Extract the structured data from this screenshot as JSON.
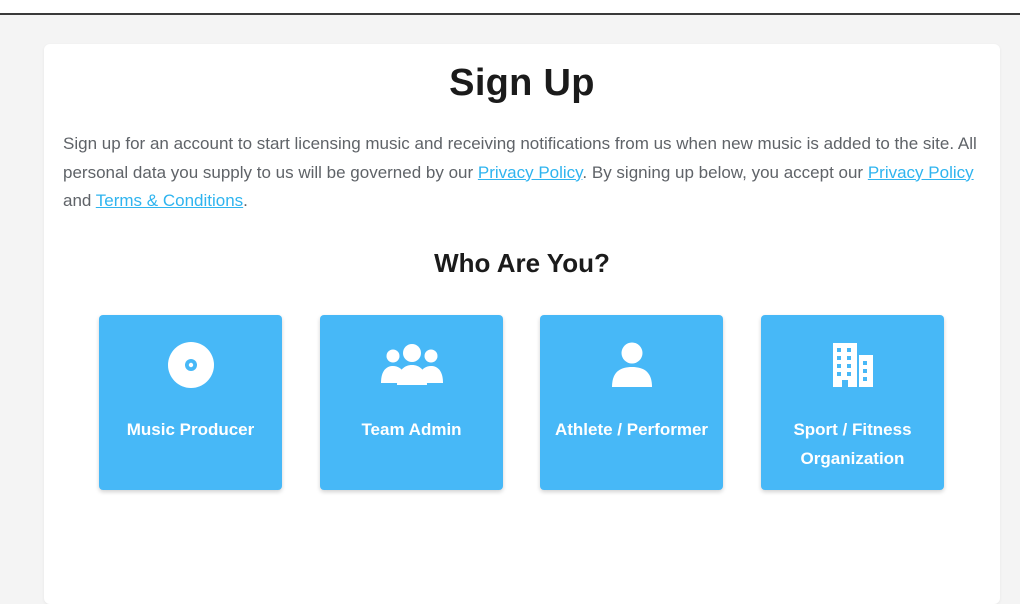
{
  "page": {
    "title": "Sign Up",
    "intro": {
      "part1": "Sign up for an account to start licensing music and receiving notifications from us when new music is added to the site. All personal data you supply to us will be governed by our ",
      "link1": "Privacy Policy",
      "part2": ". By signing up below, you accept our ",
      "link2": "Privacy Policy",
      "part3": " and ",
      "link3": "Terms & Conditions",
      "part4": "."
    },
    "subtitle": "Who Are You?"
  },
  "roles": [
    {
      "label": "Music Producer",
      "icon": "disc-icon"
    },
    {
      "label": "Team Admin",
      "icon": "users-icon"
    },
    {
      "label": "Athlete / Performer",
      "icon": "user-icon"
    },
    {
      "label": "Sport / Fitness Organization",
      "icon": "building-icon"
    }
  ],
  "colors": {
    "accent": "#47b8f7",
    "link": "#2fb4ef",
    "heading": "#1b1b1b",
    "body_text": "#5f6368",
    "background": "#f4f4f4"
  }
}
